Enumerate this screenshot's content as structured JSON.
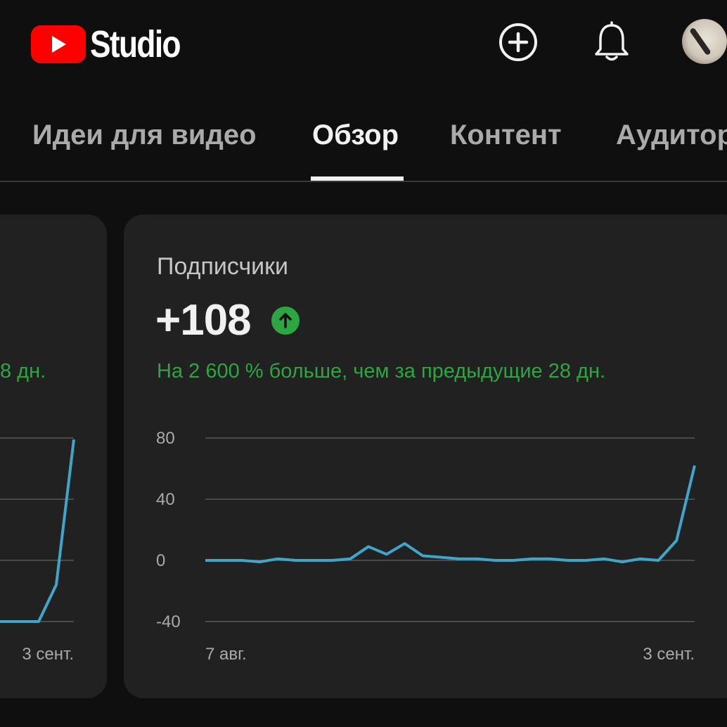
{
  "header": {
    "studio_label": "Studio",
    "icons": [
      "create-icon",
      "notifications-icon",
      "avatar"
    ]
  },
  "tabs": [
    {
      "label": "Идеи для видео",
      "active": false
    },
    {
      "label": "Обзор",
      "active": true
    },
    {
      "label": "Контент",
      "active": false
    },
    {
      "label": "Аудитор",
      "active": false
    }
  ],
  "left_card": {
    "compare_text": "8 дн.",
    "x_label_end": "3 сент."
  },
  "subscribers_card": {
    "title": "Подписчики",
    "value": "+108",
    "trend": "up",
    "compare_text": "На 2 600 % больше, чем за предыдущие 28 дн."
  },
  "colors": {
    "accent_positive": "#2ba640",
    "line": "#3ea6c9",
    "brand_red": "#ff0000"
  },
  "chart_data": [
    {
      "type": "line",
      "title": "",
      "xlabel": "",
      "ylabel": "",
      "yticks": [
        "80",
        "40",
        "0",
        "-40"
      ],
      "ylim": [
        -40,
        80
      ],
      "x_labels": [
        "7 авг.",
        "3 сент."
      ],
      "grid": true,
      "series": [
        {
          "values": [
            0,
            0,
            0,
            -1,
            1,
            0,
            0,
            0,
            1,
            9,
            4,
            11,
            3,
            2,
            1,
            1,
            0,
            0,
            1,
            1,
            0,
            0,
            1,
            -1,
            1,
            0,
            13,
            62
          ]
        }
      ]
    },
    {
      "type": "line",
      "partial": true,
      "x_labels": [
        "3 сент."
      ],
      "series": [
        {
          "values": [
            -40,
            -40,
            -40,
            -16,
            79
          ]
        }
      ]
    }
  ]
}
